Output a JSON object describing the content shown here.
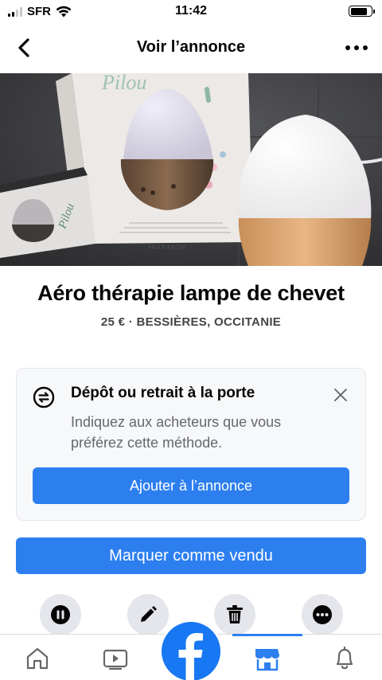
{
  "status_bar": {
    "carrier": "SFR",
    "time": "11:42"
  },
  "header": {
    "title": "Voir l’annonce"
  },
  "listing": {
    "title": "Aéro thérapie lampe de chevet",
    "price_location": "25 € · BESSIÈRES, OCCITANIE"
  },
  "photo": {
    "box_brand": "Pilou",
    "box_maker": "PRANARÔM",
    "leaflet_brand": "Pilou"
  },
  "pickup_card": {
    "title": "Dépôt ou retrait à la porte",
    "text": "Indiquez aux acheteurs que vous préférez cette méthode.",
    "button": "Ajouter à l’annonce"
  },
  "actions": {
    "mark_sold": "Marquer comme vendu"
  },
  "colors": {
    "accent": "#2d7ff0",
    "facebook_blue": "#1877f2",
    "secondary_text": "#65676b"
  },
  "icons": {
    "round_actions": [
      "pause-icon",
      "pencil-icon",
      "trash-icon",
      "more-icon"
    ],
    "tabs": [
      "home-icon",
      "watch-icon",
      "facebook-icon",
      "marketplace-icon",
      "bell-icon"
    ]
  }
}
